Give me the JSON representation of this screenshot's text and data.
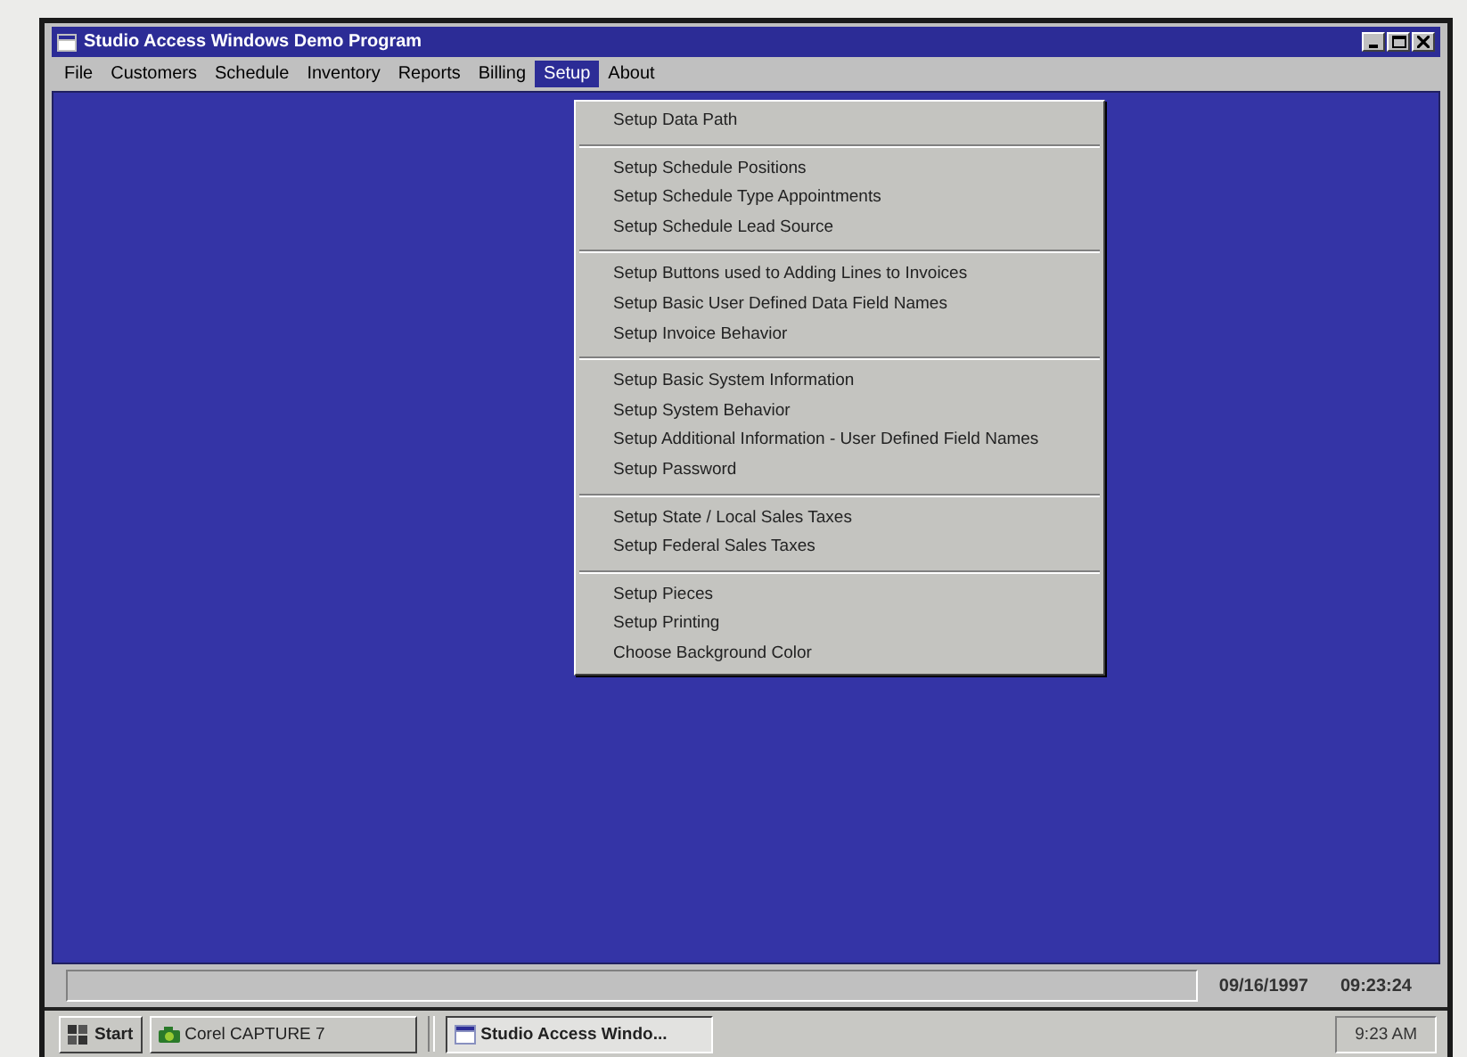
{
  "window": {
    "title": "Studio Access Windows Demo Program"
  },
  "menu_bar": {
    "items": [
      {
        "label": "File",
        "selected": false
      },
      {
        "label": "Customers",
        "selected": false
      },
      {
        "label": "Schedule",
        "selected": false
      },
      {
        "label": "Inventory",
        "selected": false
      },
      {
        "label": "Reports",
        "selected": false
      },
      {
        "label": "Billing",
        "selected": false
      },
      {
        "label": "Setup",
        "selected": true
      },
      {
        "label": "About",
        "selected": false
      }
    ]
  },
  "dropdown": {
    "groups": [
      {
        "items": [
          "Setup Data Path"
        ]
      },
      {
        "items": [
          "Setup Schedule Positions",
          "Setup Schedule Type Appointments",
          "Setup Schedule Lead Source"
        ]
      },
      {
        "items": [
          "Setup Buttons used to Adding Lines to Invoices",
          "Setup Basic User Defined Data Field Names",
          "Setup Invoice Behavior"
        ]
      },
      {
        "items": [
          "Setup Basic System Information",
          "Setup System Behavior",
          "Setup Additional Information - User Defined Field Names",
          "Setup Password"
        ]
      },
      {
        "items": [
          "Setup State / Local Sales Taxes",
          "Setup Federal Sales Taxes"
        ]
      },
      {
        "items": [
          "Setup Pieces",
          "Setup Printing",
          "Choose Background Color"
        ]
      }
    ]
  },
  "status_bar": {
    "date": "09/16/1997",
    "time": "09:23:24"
  },
  "taskbar": {
    "start": "Start",
    "tasks": [
      {
        "label": "Corel CAPTURE 7",
        "selected": false
      },
      {
        "label": "Studio Access Windo...",
        "selected": true
      }
    ],
    "clock": "9:23 AM"
  }
}
